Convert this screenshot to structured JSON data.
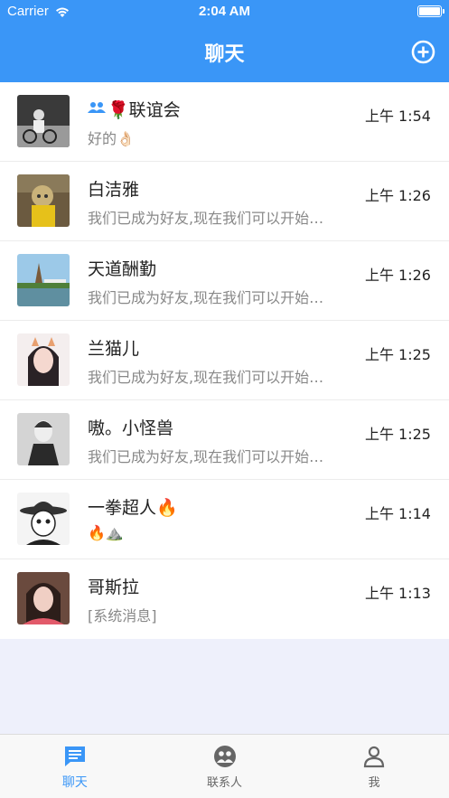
{
  "status_bar": {
    "carrier": "Carrier",
    "time": "2:04 AM"
  },
  "header": {
    "title": "聊天"
  },
  "chats": [
    {
      "name": "🌹联谊会",
      "is_group": true,
      "preview": "好的👌🏻",
      "time": "上午 1:54"
    },
    {
      "name": "白洁雅",
      "is_group": false,
      "preview": "我们已成为好友,现在我们可以开始聊天了",
      "time": "上午 1:26"
    },
    {
      "name": "天道酬勤",
      "is_group": false,
      "preview": "我们已成为好友,现在我们可以开始聊天了",
      "time": "上午 1:26"
    },
    {
      "name": "兰猫儿",
      "is_group": false,
      "preview": "我们已成为好友,现在我们可以开始聊天了",
      "time": "上午 1:25"
    },
    {
      "name": "嗷。小怪兽",
      "is_group": false,
      "preview": "我们已成为好友,现在我们可以开始聊天了",
      "time": "上午 1:25"
    },
    {
      "name": "一拳超人🔥",
      "is_group": false,
      "preview": "🔥⛰️",
      "time": "上午 1:14"
    },
    {
      "name": "哥斯拉",
      "is_group": false,
      "preview": "[系统消息]",
      "time": "上午 1:13"
    }
  ],
  "tabs": [
    {
      "label": "聊天",
      "icon": "chat-bubble-icon",
      "active": true
    },
    {
      "label": "联系人",
      "icon": "contacts-icon",
      "active": false
    },
    {
      "label": "我",
      "icon": "person-icon",
      "active": false
    }
  ],
  "colors": {
    "accent": "#3a96f7",
    "background": "#eef0fb"
  }
}
